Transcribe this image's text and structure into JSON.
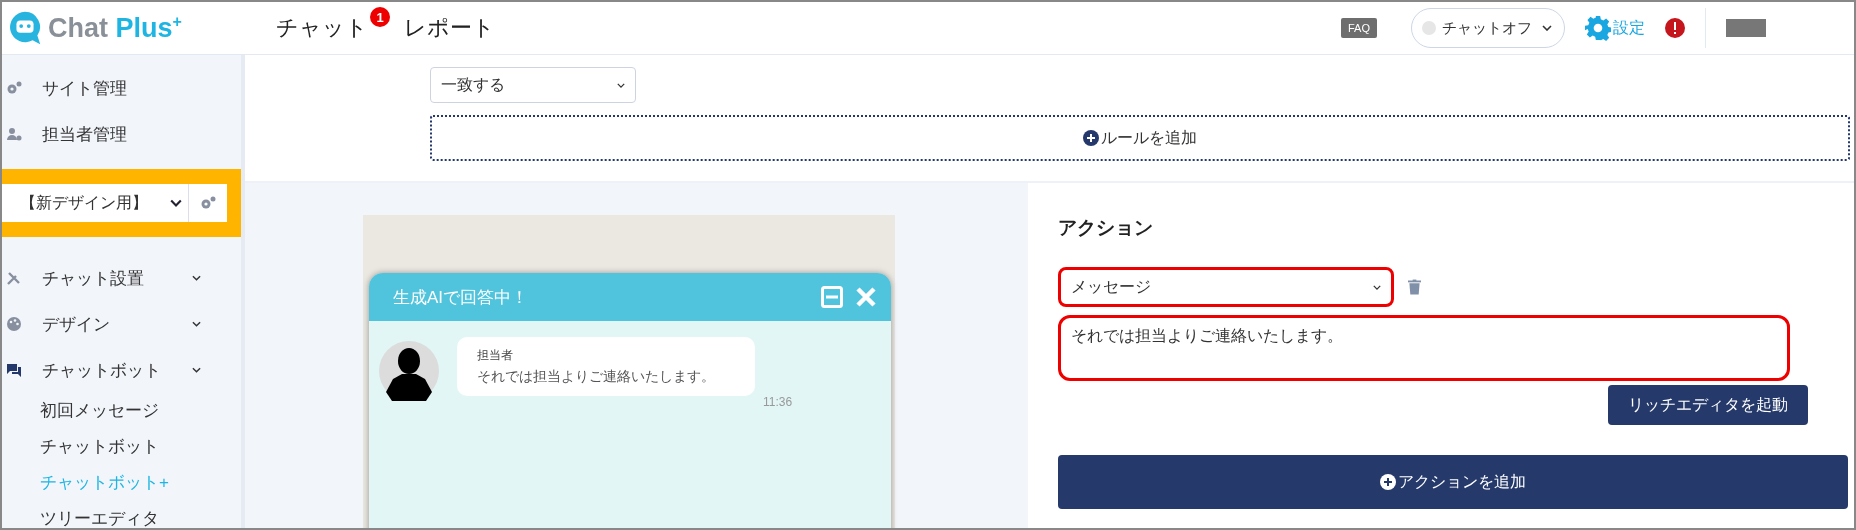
{
  "header": {
    "logo": {
      "first": "Chat",
      "second": "Plus",
      "mark": "+"
    },
    "nav": [
      {
        "label": "チャット",
        "badge": "1"
      },
      {
        "label": "レポート"
      }
    ],
    "faq": "FAQ",
    "chat_status": {
      "label": "チャットオフ",
      "on": false
    },
    "settings": "設定"
  },
  "sidebar": {
    "top_items": [
      {
        "label": "サイト管理",
        "kind": "gear"
      },
      {
        "label": "担当者管理",
        "kind": "users"
      }
    ],
    "site_select": "【新デザイン用】",
    "menu": [
      {
        "label": "チャット設置",
        "kind": "tools",
        "expanded": false
      },
      {
        "label": "デザイン",
        "kind": "palette",
        "expanded": false
      },
      {
        "label": "チャットボット",
        "kind": "chat",
        "expanded": true,
        "children": [
          {
            "label": "初回メッセージ",
            "selected": false
          },
          {
            "label": "チャットボット",
            "selected": false
          },
          {
            "label": "チャットボット+",
            "selected": true
          },
          {
            "label": "ツリーエディタ",
            "selected": false
          }
        ]
      }
    ]
  },
  "rules": {
    "match_select": "一致する",
    "add_rule": "ルールを追加"
  },
  "preview": {
    "title": "生成AIで回答中！",
    "sender": "担当者",
    "message": "それでは担当よりご連絡いたします。",
    "time": "11:36"
  },
  "action": {
    "heading": "アクション",
    "type_select": "メッセージ",
    "text": "それでは担当よりご連絡いたします。",
    "rich_editor": "リッチエディタを起動",
    "add_action": "アクションを追加"
  }
}
